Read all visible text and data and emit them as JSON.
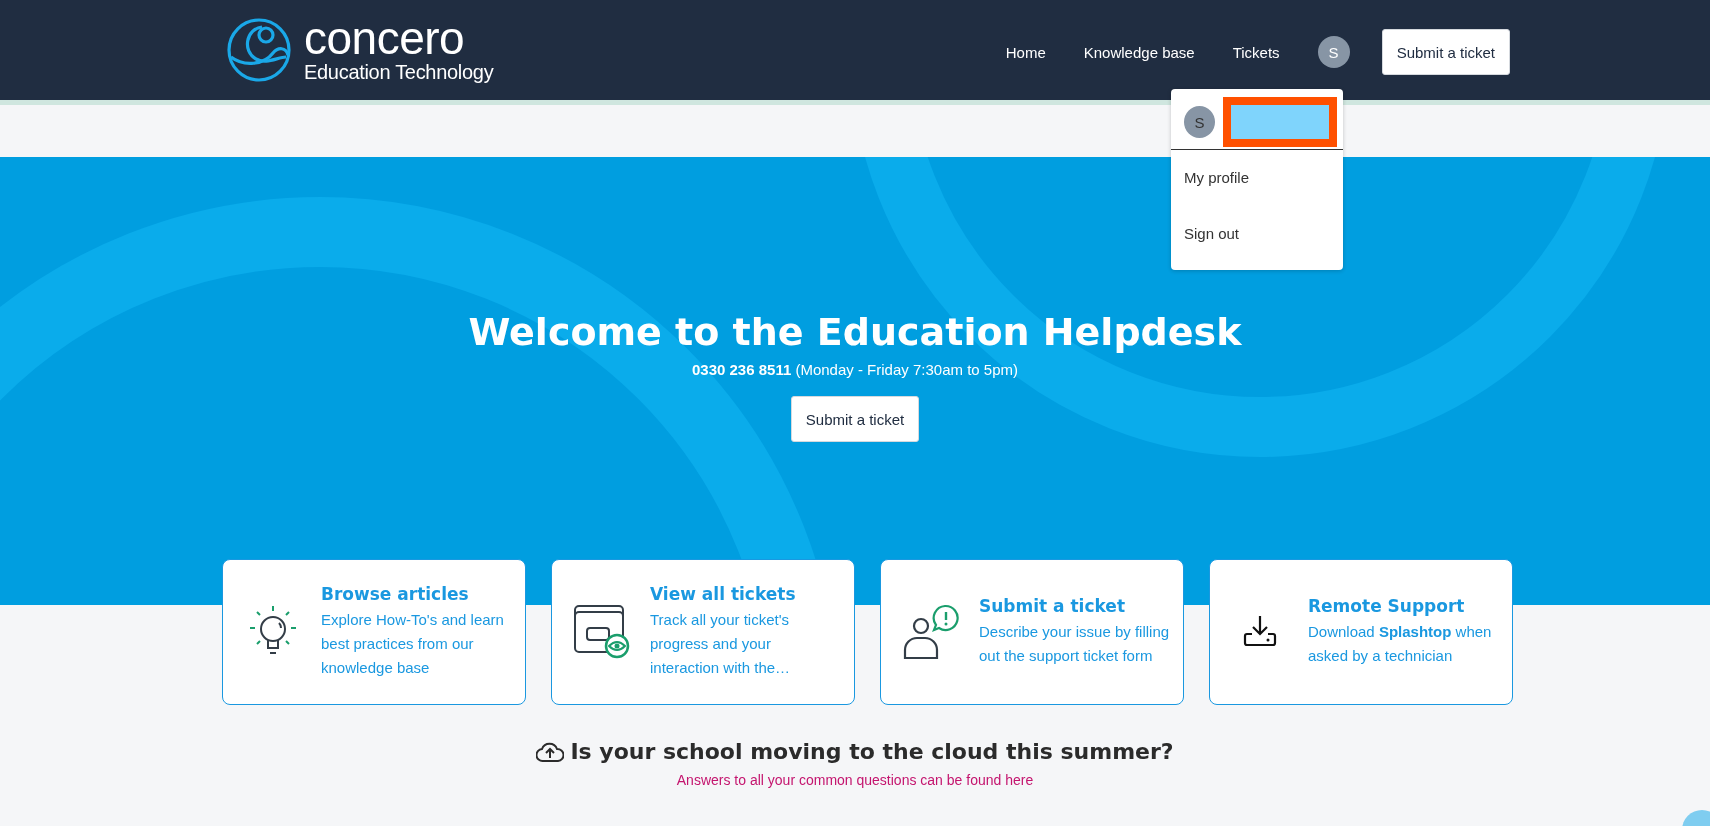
{
  "header": {
    "logo": {
      "name": "concero",
      "tagline": "Education Technology"
    },
    "nav": [
      {
        "label": "Home"
      },
      {
        "label": "Knowledge base"
      },
      {
        "label": "Tickets"
      }
    ],
    "avatar": "S",
    "submit_button": "Submit a ticket"
  },
  "user_menu": {
    "expanded": true,
    "avatar": "S",
    "items": [
      {
        "label": "My profile"
      },
      {
        "label": "Sign out"
      }
    ]
  },
  "hero": {
    "title": "Welcome to the Education Helpdesk",
    "phone": "**0330 236 8511** (Monday - Friday 7:30am to 5pm)",
    "button": "Submit a ticket"
  },
  "cards": [
    {
      "kind": "articles",
      "title": "Browse articles",
      "text": "Explore How-To's and learn best practices from our knowledge base"
    },
    {
      "kind": "tickets",
      "title": "View all tickets",
      "text": "Track all your ticket's progress and your interaction with the…"
    },
    {
      "kind": "submit",
      "title": "Submit a ticket",
      "text": "Describe your issue by filling out the support ticket form"
    },
    {
      "kind": "remote",
      "title": "Remote Support",
      "text": "Download **Splashtop** when asked by a technician"
    }
  ],
  "promo": {
    "title": "Is your school moving to the cloud this summer?",
    "link": "Answers to all your common questions can be found here"
  }
}
